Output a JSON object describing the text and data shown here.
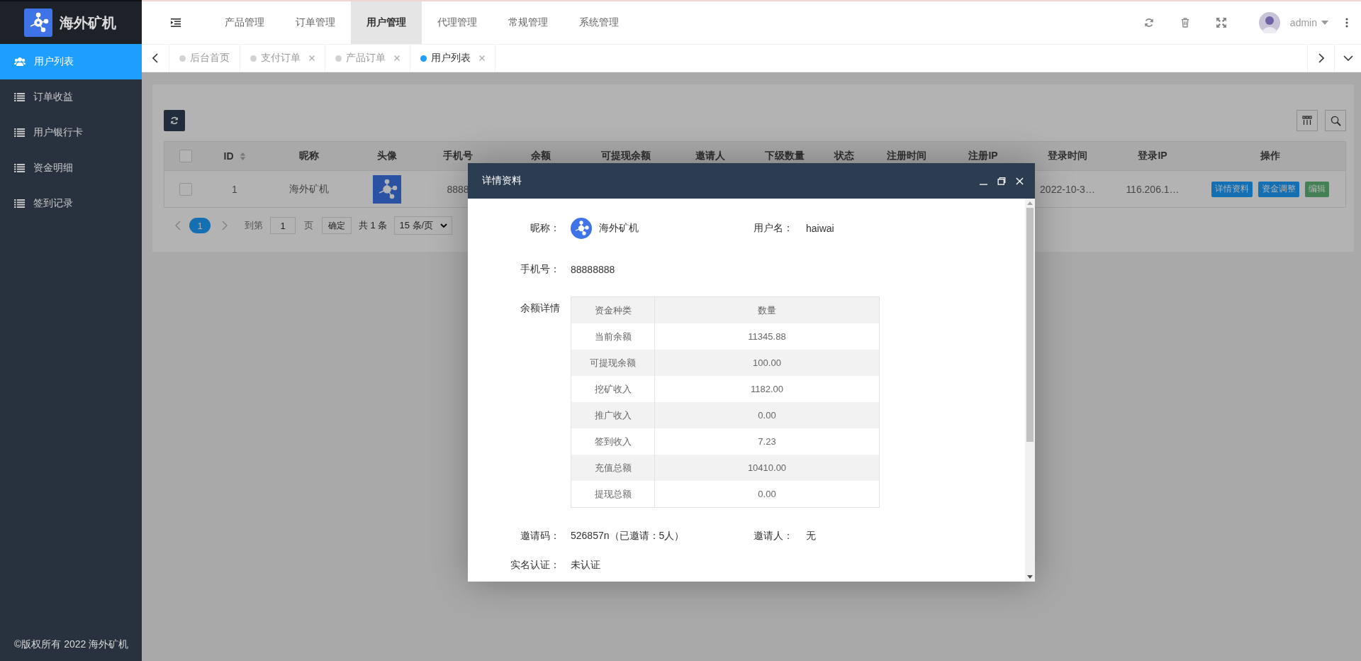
{
  "header": {
    "logo": "海外矿机",
    "nav": [
      {
        "label": "产品管理",
        "selected": false
      },
      {
        "label": "订单管理",
        "selected": false
      },
      {
        "label": "用户管理",
        "selected": true
      },
      {
        "label": "代理管理",
        "selected": false
      },
      {
        "label": "常规管理",
        "selected": false
      },
      {
        "label": "系统管理",
        "selected": false
      }
    ],
    "user": "admin"
  },
  "sidebar": {
    "items": [
      {
        "label": "用户列表",
        "selected": true
      },
      {
        "label": "订单收益",
        "selected": false
      },
      {
        "label": "用户银行卡",
        "selected": false
      },
      {
        "label": "资金明细",
        "selected": false
      },
      {
        "label": "签到记录",
        "selected": false
      }
    ],
    "footer": "©版权所有 2022 海外矿机"
  },
  "tabs": [
    {
      "label": "后台首页",
      "selected": false,
      "closable": false
    },
    {
      "label": "支付订单",
      "selected": false,
      "closable": true
    },
    {
      "label": "产品订单",
      "selected": false,
      "closable": true
    },
    {
      "label": "用户列表",
      "selected": true,
      "closable": true
    }
  ],
  "table": {
    "header_checked": false,
    "columns": [
      {
        "label": "ID",
        "sortable": true
      },
      {
        "label": "昵称",
        "sortable": false
      },
      {
        "label": "头像",
        "sortable": false
      },
      {
        "label": "手机号",
        "sortable": false
      },
      {
        "label": "余额",
        "sortable": false
      },
      {
        "label": "可提现余额",
        "sortable": false
      },
      {
        "label": "邀请人",
        "sortable": false
      },
      {
        "label": "下级数量",
        "sortable": false
      },
      {
        "label": "状态",
        "sortable": false
      },
      {
        "label": "注册时间",
        "sortable": false
      },
      {
        "label": "注册IP",
        "sortable": false
      },
      {
        "label": "登录时间",
        "sortable": false
      },
      {
        "label": "登录IP",
        "sortable": false
      },
      {
        "label": "操作",
        "sortable": false
      }
    ],
    "rows": [
      {
        "checked": false,
        "cells": [
          {
            "kind": "text",
            "text": "1"
          },
          {
            "kind": "text",
            "text": "海外矿机"
          },
          {
            "kind": "avatar"
          },
          {
            "kind": "text",
            "text": "8888"
          },
          {
            "kind": "covered"
          },
          {
            "kind": "covered"
          },
          {
            "kind": "covered"
          },
          {
            "kind": "covered"
          },
          {
            "kind": "covered"
          },
          {
            "kind": "covered"
          },
          {
            "kind": "covered"
          },
          {
            "kind": "text",
            "text": "2022-10-3…"
          },
          {
            "kind": "text",
            "text": "116.206.1…"
          },
          {
            "kind": "actions",
            "buttons": [
              {
                "label": "详情资料",
                "color": "#156fb3"
              },
              {
                "label": "资金调整",
                "color": "#156fb3"
              },
              {
                "label": "编辑",
                "color": "#438154"
              }
            ]
          }
        ]
      }
    ]
  },
  "pagination": {
    "pages": [
      {
        "label": "1",
        "selected": true
      }
    ],
    "goto_label": "到第",
    "goto_value": "1",
    "page_unit": "页",
    "confirm": "确定",
    "total": "共 1 条",
    "page_size": "15 条/页"
  },
  "modal": {
    "title": "详情资料",
    "rows": [
      {
        "kind": "pair",
        "items": [
          {
            "label": "昵称：",
            "value": "海外矿机",
            "avatar": true
          },
          {
            "label": "用户名：",
            "value": "haiwai",
            "avatar": false
          }
        ]
      },
      {
        "kind": "pair",
        "items": [
          {
            "label": "手机号：",
            "value": "88888888",
            "avatar": false
          }
        ]
      },
      {
        "kind": "table",
        "label": "余额详情",
        "columns": [
          "资金种类",
          "数量"
        ],
        "rows": [
          [
            "当前余额",
            "11345.88"
          ],
          [
            "可提现余额",
            "100.00"
          ],
          [
            "挖矿收入",
            "1182.00"
          ],
          [
            "推广收入",
            "0.00"
          ],
          [
            "签到收入",
            "7.23"
          ],
          [
            "充值总额",
            "10410.00"
          ],
          [
            "提现总额",
            "0.00"
          ]
        ]
      },
      {
        "kind": "pair",
        "items": [
          {
            "label": "邀请码：",
            "value": "526857n（已邀请：5人）",
            "avatar": false
          },
          {
            "label": "邀请人：",
            "value": "无",
            "avatar": false
          }
        ]
      },
      {
        "kind": "pair",
        "items": [
          {
            "label": "实名认证：",
            "value": "未认证",
            "avatar": false
          }
        ]
      }
    ]
  }
}
